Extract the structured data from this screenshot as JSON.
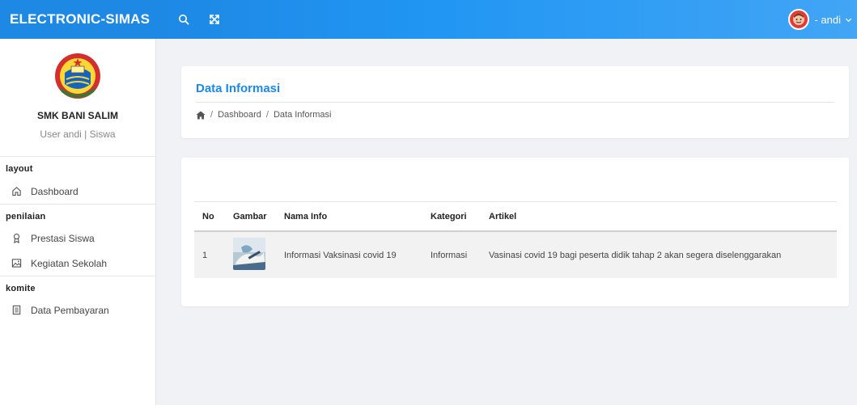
{
  "app": {
    "brand": "ELECTRONIC-SIMAS",
    "user": "- andi",
    "colors": {
      "primary": "#1e88e5",
      "avatar": "#e53935"
    }
  },
  "topbar": {
    "icons": [
      "search-icon",
      "fullscreen-icon"
    ]
  },
  "sidebar": {
    "school": "SMK BANI SALIM",
    "role": "User andi | Siswa",
    "sections": [
      {
        "label": "layout",
        "items": [
          {
            "label": "Dashboard",
            "icon": "home-icon"
          }
        ]
      },
      {
        "label": "penilaian",
        "items": [
          {
            "label": "Prestasi Siswa",
            "icon": "award-icon"
          },
          {
            "label": "Kegiatan Sekolah",
            "icon": "image-icon"
          }
        ]
      },
      {
        "label": "komite",
        "items": [
          {
            "label": "Data Pembayaran",
            "icon": "document-icon"
          }
        ]
      }
    ]
  },
  "page": {
    "title": "Data Informasi",
    "breadcrumb": {
      "home": "Dashboard",
      "current": "Data Informasi",
      "separator": "/"
    }
  },
  "table": {
    "headers": [
      "No",
      "Gambar",
      "Nama Info",
      "Kategori",
      "Artikel"
    ],
    "rows": [
      {
        "no": "1",
        "image": "thumbnail",
        "nama_info": "Informasi Vaksinasi covid 19",
        "kategori": "Informasi",
        "artikel": "Vasinasi covid 19 bagi peserta didik tahap 2 akan segera diselenggarakan"
      }
    ]
  }
}
